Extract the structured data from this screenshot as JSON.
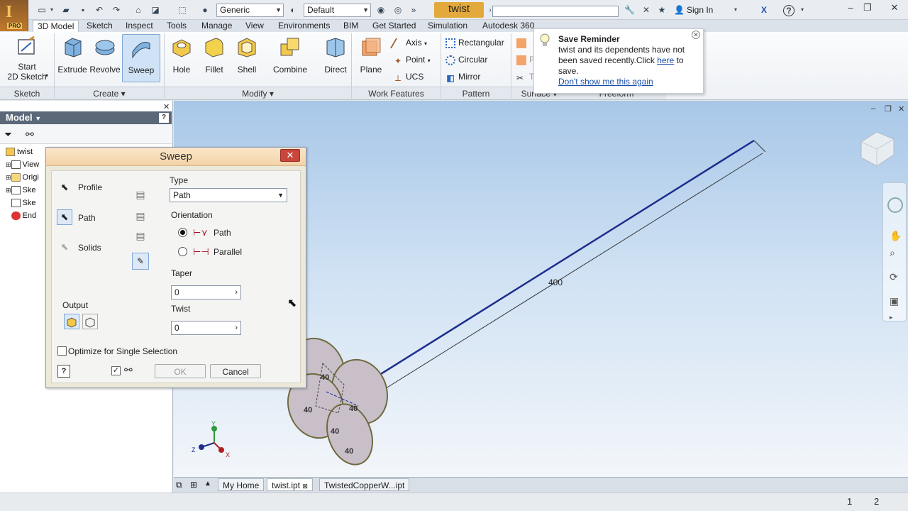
{
  "app": {
    "title": "twist",
    "logo": "I",
    "edition": "PRO"
  },
  "quick_access": {
    "material": "Generic",
    "appearance": "Default",
    "search_placeholder": "",
    "sign_in": "Sign In"
  },
  "tabs": [
    "3D Model",
    "Sketch",
    "Inspect",
    "Tools",
    "Manage",
    "View",
    "Environments",
    "BIM",
    "Get Started",
    "Simulation",
    "Autodesk 360"
  ],
  "active_tab": "3D Model",
  "ribbon": {
    "sketch": {
      "start_line1": "Start",
      "start_line2": "2D Sketch",
      "panel": "Sketch"
    },
    "create": {
      "extrude": "Extrude",
      "revolve": "Revolve",
      "sweep": "Sweep",
      "panel": "Create"
    },
    "modify": {
      "hole": "Hole",
      "fillet": "Fillet",
      "shell": "Shell",
      "combine": "Combine",
      "direct": "Direct",
      "panel": "Modify"
    },
    "work": {
      "plane": "Plane",
      "axis": "Axis",
      "point": "Point",
      "ucs": "UCS",
      "panel": "Work Features"
    },
    "pattern": {
      "rectangular": "Rectangular",
      "circular": "Circular",
      "mirror": "Mirror",
      "panel": "Pattern"
    },
    "surface": {
      "panel": "Surface",
      "patch": "Patch",
      "trim": "Trim"
    },
    "freeform": {
      "panel": "Freeform"
    }
  },
  "reminder": {
    "title": "Save Reminder",
    "text1": "twist and its dependents have not",
    "text2": "been saved recently.Click",
    "link_here": "here",
    "text3": "to",
    "text4": "save.",
    "link_dont": "Don't show me this again"
  },
  "browser": {
    "header": "Model",
    "items": [
      {
        "label": "twist"
      },
      {
        "label": "View"
      },
      {
        "label": "Origi"
      },
      {
        "label": "Ske"
      },
      {
        "label": "Ske"
      },
      {
        "label": "End"
      }
    ]
  },
  "dialog": {
    "title": "Sweep",
    "profile": "Profile",
    "path": "Path",
    "solids": "Solids",
    "output": "Output",
    "optimize": "Optimize for Single Selection",
    "type_label": "Type",
    "type_value": "Path",
    "orientation_label": "Orientation",
    "orient_path": "Path",
    "orient_parallel": "Parallel",
    "taper_label": "Taper",
    "taper_value": "0",
    "twist_label": "Twist",
    "twist_value": "0",
    "ok": "OK",
    "cancel": "Cancel"
  },
  "viewport": {
    "dimension": "400",
    "circle_dims": [
      "40",
      "40",
      "40",
      "40",
      "40"
    ]
  },
  "file_tabs": [
    "My Home",
    "twist.ipt",
    "TwistedCopperW...ipt"
  ],
  "status": {
    "page1": "1",
    "page2": "2"
  }
}
